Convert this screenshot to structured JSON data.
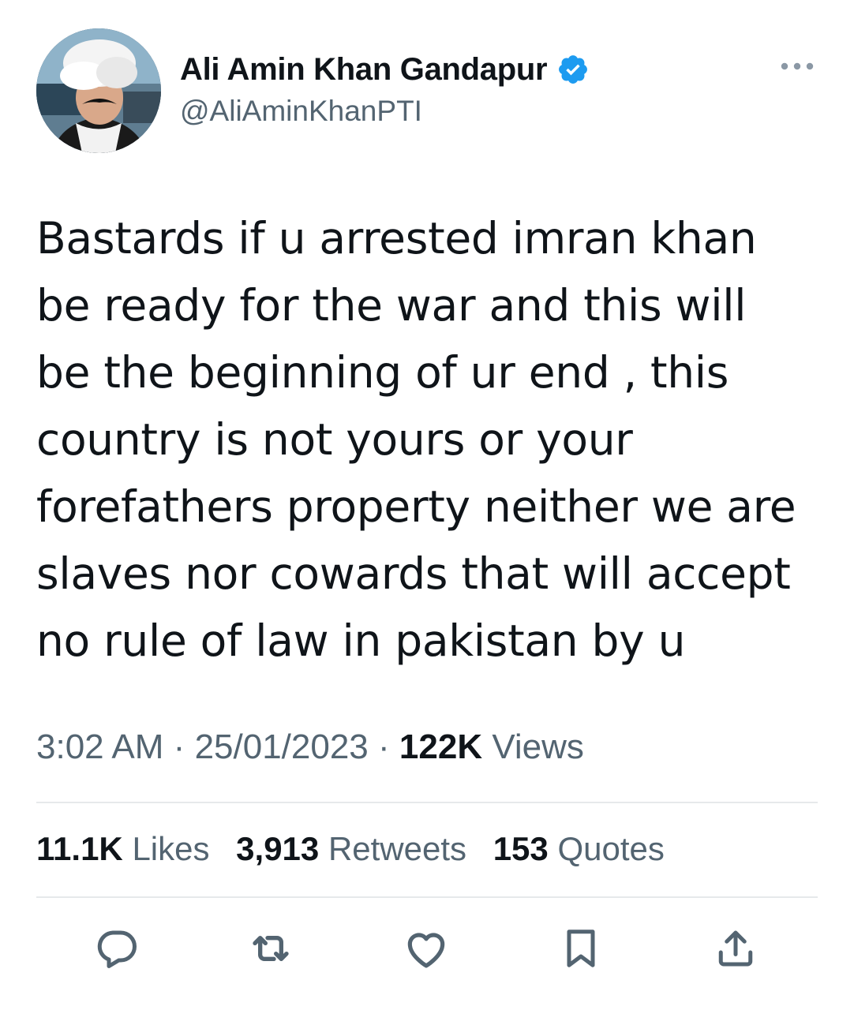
{
  "header": {
    "display_name": "Ali Amin Khan Gandapur",
    "handle": "@AliAminKhanPTI",
    "verified_icon": "verified-badge-icon",
    "more_icon": "more-horizontal-icon"
  },
  "tweet": {
    "text": "Bastards if u arrested imran khan\nbe ready for the war and this will\nbe the beginning of ur end , this\ncountry is not yours or your\nforefathers property neither we are\nslaves nor cowards that will accept\nno rule of law in pakistan by u"
  },
  "meta": {
    "time": "3:02 AM",
    "separator": "·",
    "date": "25/01/2023",
    "views_count": "122K",
    "views_label": "Views"
  },
  "stats": {
    "likes_count": "11.1K",
    "likes_label": "Likes",
    "retweets_count": "3,913",
    "retweets_label": "Retweets",
    "quotes_count": "153",
    "quotes_label": "Quotes"
  },
  "actions": [
    {
      "icon": "reply-icon"
    },
    {
      "icon": "retweet-icon"
    },
    {
      "icon": "like-icon"
    },
    {
      "icon": "bookmark-icon"
    },
    {
      "icon": "share-icon"
    }
  ],
  "colors": {
    "text_primary": "#0f1419",
    "text_secondary": "#536471",
    "verified_blue": "#1d9bf0",
    "divider": "#e6e9eb"
  }
}
